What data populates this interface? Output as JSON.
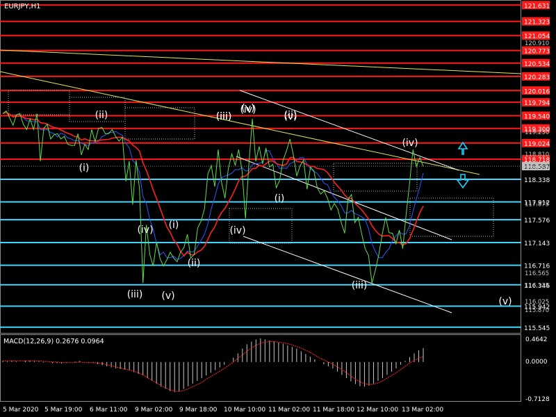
{
  "header": {
    "symbol": "EURJPY",
    "timeframe_label": "EURJPY,H1"
  },
  "indicator": {
    "label": "MACD(12,26,9) 0.2676 0.0964",
    "scale_top": "0.4642",
    "scale_zero": "0.0000",
    "scale_bottom": "-0.7128"
  },
  "colors": {
    "background": "#000000",
    "price_line": "#5ee04a",
    "red_level": "#ff1a1a",
    "cyan_level": "#40d6ff",
    "trend_yellow": "#e6e65a",
    "channel_white": "#ffffff",
    "baseline_blue": "#2b5bff",
    "ichimoku_red": "#ff2222",
    "badge_red": "#ff1a1a",
    "badge_gray": "#c0c0c0",
    "arrow_cyan": "#22ccff",
    "macd_hist": "#c8c8c8",
    "macd_signal": "#ff2a2a"
  },
  "chart_data": {
    "type": "line",
    "symbol": "EURJPY",
    "timeframe": "H1",
    "ylim": [
      115.45,
      121.7
    ],
    "x_tick_labels": [
      "5 Mar 2020",
      "5 Mar 19:00",
      "6 Mar 11:00",
      "9 Mar 02:00",
      "9 Mar 18:00",
      "10 Mar 10:00",
      "11 Mar 02:00",
      "11 Mar 18:00",
      "12 Mar 10:00",
      "13 Mar 02:00"
    ],
    "y_tick_labels": [
      120.91,
      118.81,
      118.55,
      119.23,
      116.025,
      115.87,
      117.875,
      116.565,
      116.335
    ],
    "price_levels": [
      {
        "value": 121.631,
        "label": "121.631",
        "color": "red"
      },
      {
        "value": 121.323,
        "label": "121.323",
        "color": "red"
      },
      {
        "value": 121.054,
        "label": "121.054",
        "color": "red"
      },
      {
        "value": 120.773,
        "label": "120.773",
        "color": "red"
      },
      {
        "value": 120.534,
        "label": "120.534",
        "color": "red"
      },
      {
        "value": 120.283,
        "label": "120.283",
        "color": "red"
      },
      {
        "value": 120.016,
        "label": "120.016",
        "color": "red"
      },
      {
        "value": 119.794,
        "label": "119.794",
        "color": "red"
      },
      {
        "value": 119.54,
        "label": "119.540",
        "color": "red"
      },
      {
        "value": 119.3,
        "label": "119.300",
        "color": "red"
      },
      {
        "value": 119.024,
        "label": "119.024",
        "color": "red"
      },
      {
        "value": 118.718,
        "label": "118.718",
        "color": "red"
      },
      {
        "value": 118.338,
        "label": "118.338",
        "color": "cyan"
      },
      {
        "value": 117.912,
        "label": "117.912",
        "color": "cyan"
      },
      {
        "value": 117.576,
        "label": "117.576",
        "color": "cyan"
      },
      {
        "value": 117.143,
        "label": "117.143",
        "color": "cyan"
      },
      {
        "value": 116.716,
        "label": "116.716",
        "color": "cyan"
      },
      {
        "value": 116.346,
        "label": "116.346",
        "color": "cyan"
      },
      {
        "value": 115.942,
        "label": "115.942",
        "color": "cyan"
      },
      {
        "value": 115.545,
        "label": "115.545",
        "color": "cyan"
      }
    ],
    "current_price": {
      "value": 118.587,
      "label": "118.587"
    },
    "wave_labels": [
      "(i)",
      "(ii)",
      "(iii)",
      "(iv)",
      "(v)",
      "(i)",
      "(ii)",
      "(iii)",
      "(iv)",
      "(v)",
      "(iii)",
      "(v)",
      "(ii)",
      "(i)",
      "(iv)",
      "(iii)",
      "(iv)",
      "(v)"
    ],
    "price_series": [
      119.58,
      119.63,
      119.5,
      119.36,
      119.56,
      119.58,
      119.38,
      119.28,
      119.48,
      119.28,
      119.58,
      118.68,
      119.3,
      119.38,
      119.1,
      119.18,
      119.2,
      119.1,
      119.15,
      119.0,
      118.98,
      118.98,
      119.2,
      118.8,
      119.0,
      118.9,
      119.28,
      119.05,
      119.3,
      119.32,
      119.2,
      119.2,
      119.28,
      119.15,
      119.06,
      119.13,
      118.3,
      118.68,
      117.86,
      118.7,
      118.16,
      116.38,
      117.48,
      116.92,
      116.7,
      117.15,
      116.84,
      116.7,
      116.82,
      116.96,
      116.85,
      116.78,
      116.96,
      117.05,
      117.3,
      116.85,
      116.92,
      117.42,
      117.55,
      117.78,
      118.44,
      118.6,
      118.2,
      118.9,
      118.28,
      117.98,
      118.55,
      118.82,
      118.6,
      118.9,
      118.5,
      117.6,
      118.62,
      119.48,
      118.68,
      118.96,
      118.63,
      118.93,
      118.57,
      118.62,
      118.18,
      118.32,
      118.7,
      118.88,
      119.1,
      118.8,
      118.4,
      118.6,
      118.7,
      118.15,
      118.57,
      118.5,
      118.18,
      118.06,
      118.12,
      117.98,
      117.76,
      117.88,
      117.78,
      117.52,
      117.32,
      117.96,
      118.05,
      117.52,
      117.62,
      117.3,
      117.03,
      116.9,
      116.38,
      116.62,
      116.92,
      117.3,
      117.62,
      117.33,
      117.32,
      117.12,
      117.38,
      117.03,
      117.68,
      118.26,
      118.9,
      118.58,
      118.75,
      118.58
    ],
    "macd_histogram": [
      0.02,
      0.01,
      0.03,
      0.01,
      0.0,
      0.02,
      0.03,
      0.02,
      0.01,
      -0.01,
      0.0,
      -0.02,
      -0.02,
      -0.03,
      -0.01,
      0.0,
      0.01,
      0.02,
      0.0,
      -0.01,
      -0.02,
      -0.04,
      -0.06,
      -0.08,
      -0.1,
      -0.12,
      -0.13,
      -0.14,
      -0.16,
      -0.19,
      -0.22,
      -0.25,
      -0.3,
      -0.35,
      -0.4,
      -0.46,
      -0.5,
      -0.54,
      -0.56,
      -0.55,
      -0.5,
      -0.45,
      -0.4,
      -0.35,
      -0.3,
      -0.25,
      -0.2,
      -0.15,
      -0.1,
      -0.05,
      0.0,
      0.08,
      0.16,
      0.25,
      0.33,
      0.38,
      0.42,
      0.44,
      0.42,
      0.4,
      0.38,
      0.36,
      0.34,
      0.31,
      0.28,
      0.25,
      0.2,
      0.15,
      0.1,
      0.05,
      0.0,
      -0.04,
      -0.08,
      -0.12,
      -0.18,
      -0.24,
      -0.3,
      -0.36,
      -0.41,
      -0.45,
      -0.46,
      -0.44,
      -0.4,
      -0.35,
      -0.3,
      -0.24,
      -0.18,
      -0.12,
      -0.05,
      0.02,
      0.09,
      0.16,
      0.22,
      0.26
    ],
    "macd_signal": [
      0.02,
      0.02,
      0.02,
      0.02,
      0.02,
      0.02,
      0.02,
      0.02,
      0.02,
      0.01,
      0.01,
      0.0,
      0.0,
      -0.01,
      -0.01,
      -0.01,
      -0.01,
      0.0,
      -0.01,
      -0.01,
      -0.01,
      -0.02,
      -0.03,
      -0.05,
      -0.07,
      -0.09,
      -0.11,
      -0.13,
      -0.15,
      -0.17,
      -0.2,
      -0.24,
      -0.29,
      -0.34,
      -0.39,
      -0.44,
      -0.48,
      -0.52,
      -0.54,
      -0.55,
      -0.53,
      -0.5,
      -0.46,
      -0.42,
      -0.38,
      -0.32,
      -0.27,
      -0.22,
      -0.17,
      -0.12,
      -0.06,
      0.0,
      0.07,
      0.13,
      0.2,
      0.26,
      0.31,
      0.35,
      0.37,
      0.38,
      0.38,
      0.37,
      0.36,
      0.34,
      0.32,
      0.29,
      0.26,
      0.22,
      0.18,
      0.13,
      0.08,
      0.04,
      0.0,
      -0.04,
      -0.09,
      -0.14,
      -0.2,
      -0.26,
      -0.32,
      -0.37,
      -0.4,
      -0.42,
      -0.41,
      -0.39,
      -0.35,
      -0.3,
      -0.25,
      -0.2,
      -0.14,
      -0.08,
      -0.02,
      0.03,
      0.07,
      0.1
    ]
  }
}
